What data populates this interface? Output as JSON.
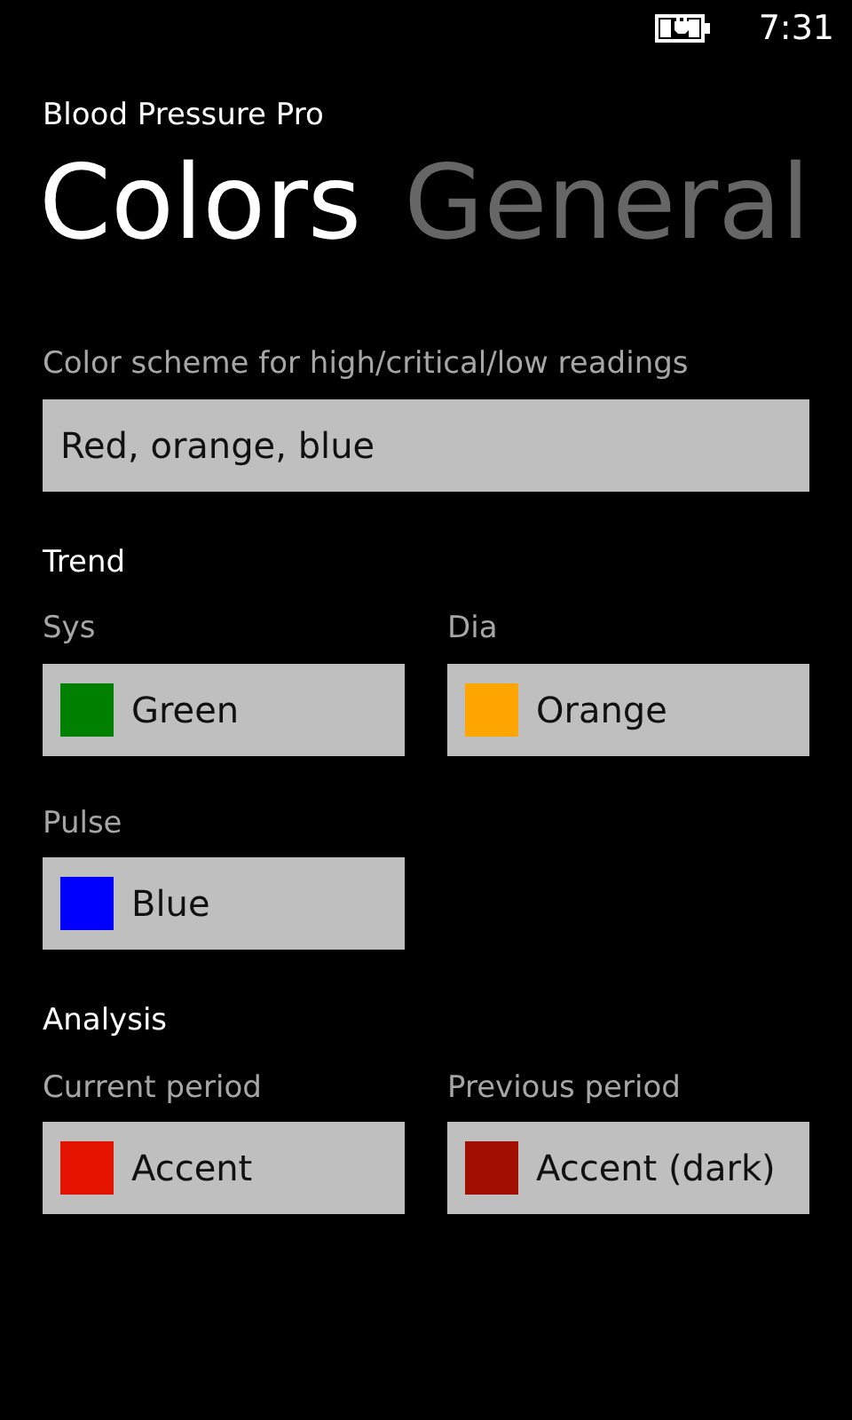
{
  "status_bar": {
    "time": "7:31"
  },
  "app_title": "Blood Pressure Pro",
  "pivot": [
    {
      "label": "Colors",
      "selected": true
    },
    {
      "label": "General",
      "selected": false
    }
  ],
  "scheme": {
    "label": "Color scheme for high/critical/low readings",
    "value": "Red, orange, blue"
  },
  "sections": [
    {
      "heading": "Trend",
      "pickers": [
        {
          "label": "Sys",
          "value": "Green",
          "color": "#008000"
        },
        {
          "label": "Dia",
          "value": "Orange",
          "color": "#ffa500"
        },
        {
          "label": "Pulse",
          "value": "Blue",
          "color": "#0000ff"
        }
      ]
    },
    {
      "heading": "Analysis",
      "pickers": [
        {
          "label": "Current period",
          "value": "Accent",
          "color": "#e51400"
        },
        {
          "label": "Previous period",
          "value": "Accent (dark)",
          "color": "#a20f00"
        }
      ]
    }
  ]
}
